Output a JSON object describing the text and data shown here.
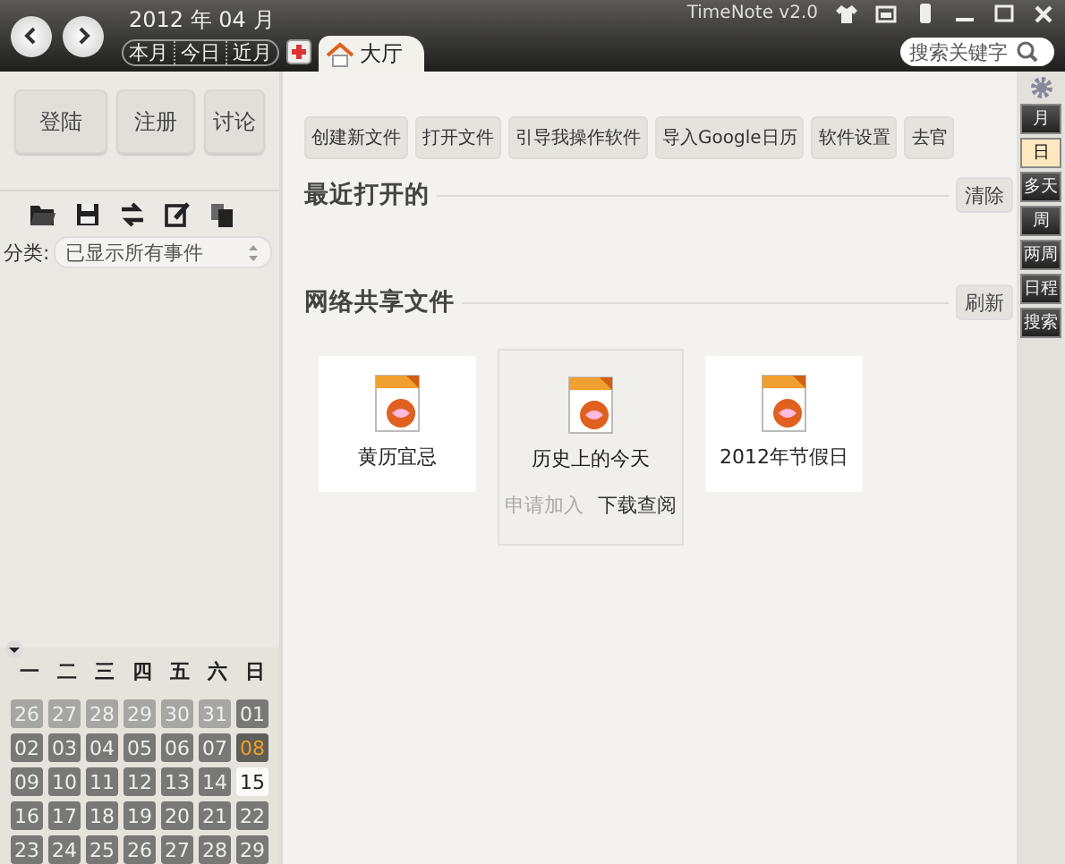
{
  "top_bar": {
    "date": "2012 年 04 月",
    "quick_buttons": [
      "本月",
      "今日",
      "近月"
    ],
    "tabs": [
      {
        "label": "大厅",
        "selected": true
      }
    ],
    "app_title": "TimeNote v2.0",
    "search": {
      "placeholder": "搜索关键字"
    }
  },
  "sidebar": {
    "account_buttons": [
      "登陆",
      "注册",
      "讨论"
    ],
    "category": {
      "label": "分类:",
      "value": "已显示所有事件"
    },
    "calendar": {
      "weekdays": [
        "一",
        "二",
        "三",
        "四",
        "五",
        "六",
        "日"
      ],
      "days": [
        {
          "label": "26",
          "kind": "outside",
          "selected": false
        },
        {
          "label": "27",
          "kind": "outside",
          "selected": false
        },
        {
          "label": "28",
          "kind": "outside",
          "selected": false
        },
        {
          "label": "29",
          "kind": "outside",
          "selected": false
        },
        {
          "label": "30",
          "kind": "outside",
          "selected": false
        },
        {
          "label": "31",
          "kind": "outside",
          "selected": false
        },
        {
          "label": "01",
          "kind": "inside",
          "selected": false
        },
        {
          "label": "02",
          "kind": "inside",
          "selected": false
        },
        {
          "label": "03",
          "kind": "inside",
          "selected": false
        },
        {
          "label": "04",
          "kind": "inside",
          "selected": false
        },
        {
          "label": "05",
          "kind": "inside",
          "selected": false
        },
        {
          "label": "06",
          "kind": "inside",
          "selected": false
        },
        {
          "label": "07",
          "kind": "inside",
          "selected": false
        },
        {
          "label": "08",
          "kind": "today",
          "selected": false
        },
        {
          "label": "09",
          "kind": "inside",
          "selected": false
        },
        {
          "label": "10",
          "kind": "inside",
          "selected": false
        },
        {
          "label": "11",
          "kind": "inside",
          "selected": false
        },
        {
          "label": "12",
          "kind": "inside",
          "selected": false
        },
        {
          "label": "13",
          "kind": "inside",
          "selected": false
        },
        {
          "label": "14",
          "kind": "inside",
          "selected": false
        },
        {
          "label": "15",
          "kind": "inside",
          "selected": true
        },
        {
          "label": "16",
          "kind": "inside",
          "selected": false
        },
        {
          "label": "17",
          "kind": "inside",
          "selected": false
        },
        {
          "label": "18",
          "kind": "inside",
          "selected": false
        },
        {
          "label": "19",
          "kind": "inside",
          "selected": false
        },
        {
          "label": "20",
          "kind": "inside",
          "selected": false
        },
        {
          "label": "21",
          "kind": "inside",
          "selected": false
        },
        {
          "label": "22",
          "kind": "inside",
          "selected": false
        },
        {
          "label": "23",
          "kind": "inside",
          "selected": false
        },
        {
          "label": "24",
          "kind": "inside",
          "selected": false
        },
        {
          "label": "25",
          "kind": "inside",
          "selected": false
        },
        {
          "label": "26",
          "kind": "inside",
          "selected": false
        },
        {
          "label": "27",
          "kind": "inside",
          "selected": false
        },
        {
          "label": "28",
          "kind": "inside",
          "selected": false
        },
        {
          "label": "29",
          "kind": "inside",
          "selected": false
        }
      ]
    }
  },
  "main": {
    "toolbar": [
      "创建新文件",
      "打开文件",
      "引导我操作软件",
      "导入Google日历",
      "软件设置",
      "去官"
    ],
    "recent": {
      "title": "最近打开的",
      "button": "清除"
    },
    "shared": {
      "title": "网络共享文件",
      "button": "刷新",
      "files": [
        {
          "name": "黄历宜忌",
          "hovered": false
        },
        {
          "name": "历史上的今天",
          "hovered": true,
          "actions": [
            {
              "label": "申请加入",
              "disabled": true
            },
            {
              "label": "下载查阅",
              "disabled": false
            }
          ]
        },
        {
          "name": "2012年节假日",
          "hovered": false
        }
      ]
    }
  },
  "view_strip": {
    "items": [
      {
        "label": "月",
        "selected": false
      },
      {
        "label": "日",
        "selected": true
      },
      {
        "label": "多天",
        "selected": false
      },
      {
        "label": "周",
        "selected": false
      },
      {
        "label": "两周",
        "selected": false
      },
      {
        "label": "日程",
        "selected": false
      },
      {
        "label": "搜索",
        "selected": false
      }
    ]
  }
}
